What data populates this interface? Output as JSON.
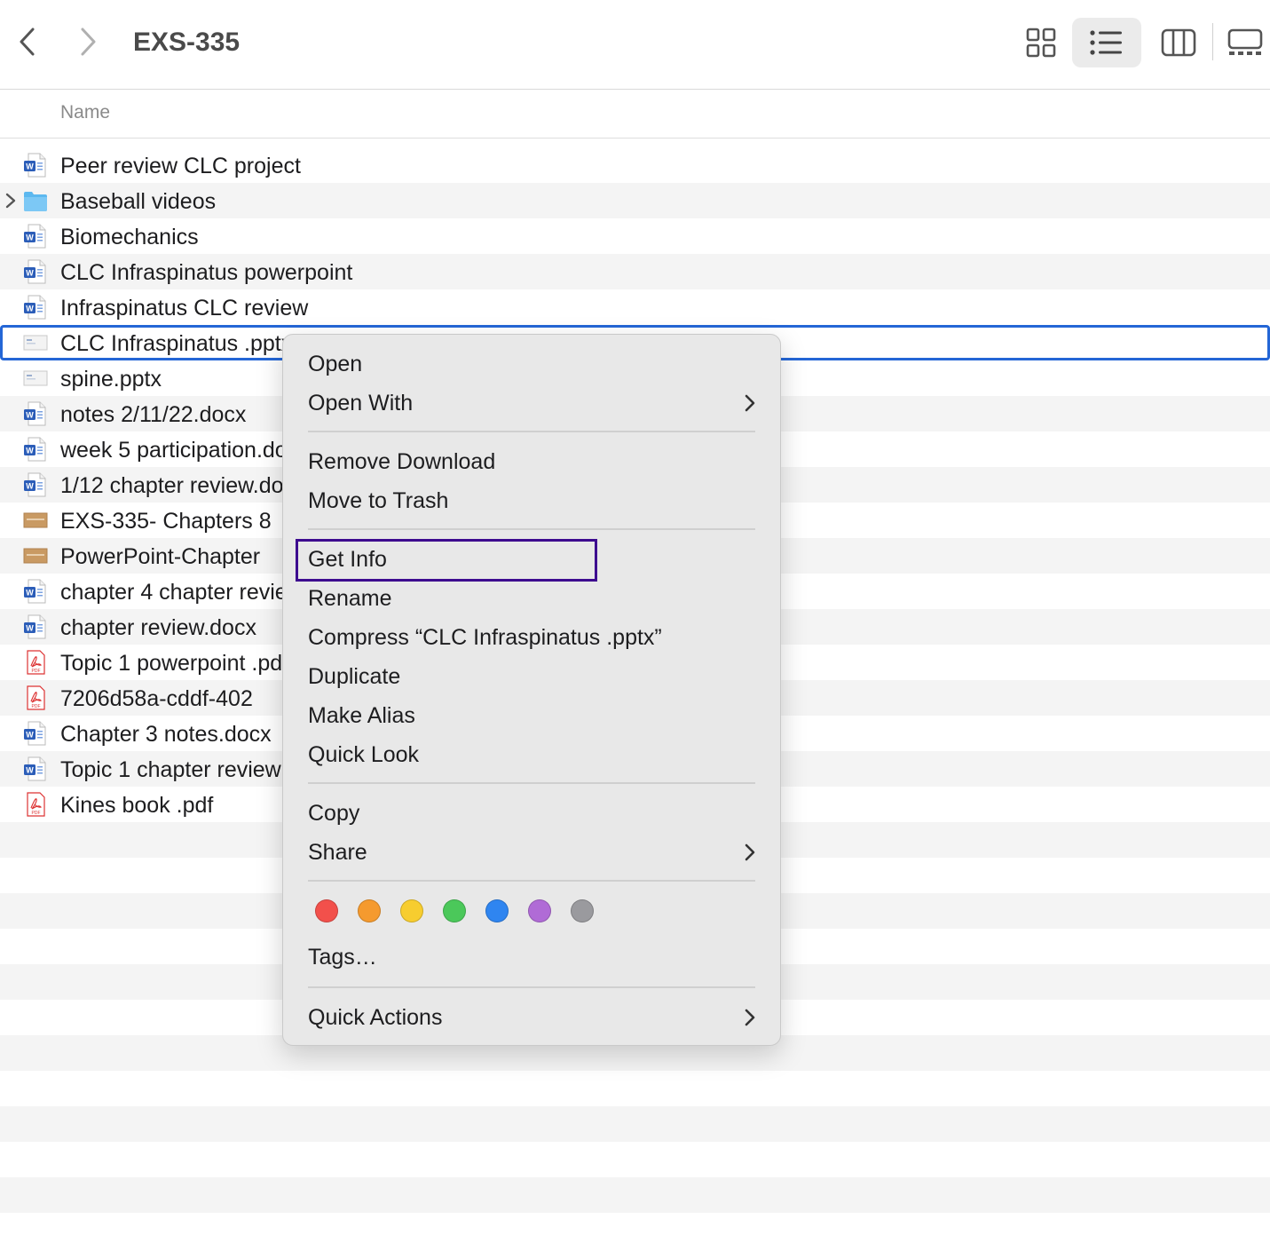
{
  "window": {
    "title": "EXS-335"
  },
  "column_header": {
    "name": "Name"
  },
  "files": [
    {
      "name": "Peer review CLC project",
      "type": "word"
    },
    {
      "name": "Baseball videos",
      "type": "folder"
    },
    {
      "name": "Biomechanics",
      "type": "word"
    },
    {
      "name": "CLC Infraspinatus powerpoint",
      "type": "word"
    },
    {
      "name": "Infraspinatus CLC review",
      "type": "word"
    },
    {
      "name": "CLC Infraspinatus .pptx",
      "type": "pptx",
      "selected": true
    },
    {
      "name": "spine.pptx",
      "type": "pptx"
    },
    {
      "name": "notes 2/11/22.docx",
      "type": "word"
    },
    {
      "name": "week 5 participation.docx",
      "type": "word"
    },
    {
      "name": "1/12 chapter review.docx",
      "type": "word"
    },
    {
      "name": "EXS-335- Chapters 8",
      "type": "slides"
    },
    {
      "name": "PowerPoint-Chapter",
      "type": "slides"
    },
    {
      "name": "chapter 4 chapter review",
      "type": "word"
    },
    {
      "name": "chapter review.docx",
      "type": "word"
    },
    {
      "name": "Topic 1 powerpoint .pdf",
      "type": "pdf"
    },
    {
      "name": "7206d58a-cddf-402",
      "type": "pdf"
    },
    {
      "name": "Chapter 3 notes.docx",
      "type": "word"
    },
    {
      "name": "Topic 1 chapter review",
      "type": "word"
    },
    {
      "name": "Kines book .pdf",
      "type": "pdf"
    }
  ],
  "context_menu": {
    "open": "Open",
    "open_with": "Open With",
    "remove_download": "Remove Download",
    "move_to_trash": "Move to Trash",
    "get_info": "Get Info",
    "rename": "Rename",
    "compress": "Compress “CLC Infraspinatus .pptx”",
    "duplicate": "Duplicate",
    "make_alias": "Make Alias",
    "quick_look": "Quick Look",
    "copy": "Copy",
    "share": "Share",
    "tags": "Tags…",
    "quick_actions": "Quick Actions",
    "tag_colors": [
      "#f2504b",
      "#f59a2e",
      "#f7cd2f",
      "#4bc85a",
      "#2f85f0",
      "#b06bd6",
      "#9a9a9e"
    ]
  },
  "selection_color": "#2466d6",
  "highlight_color": "#3d0b8f"
}
